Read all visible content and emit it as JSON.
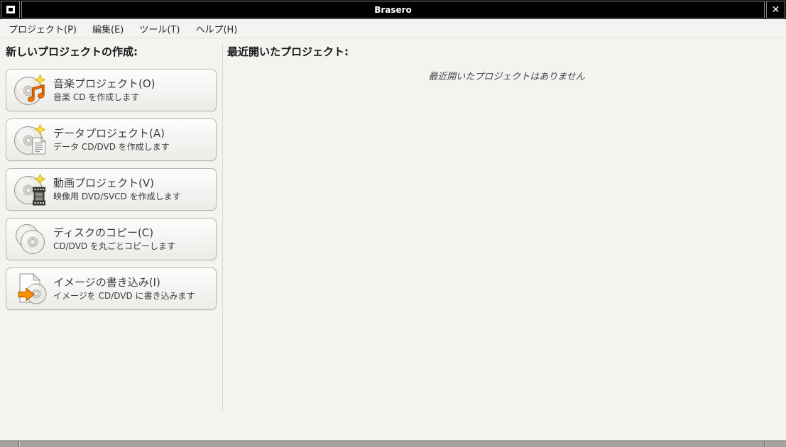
{
  "titlebar": {
    "title": "Brasero",
    "close_glyph": "✕"
  },
  "menu_bar": {
    "items": [
      {
        "label": "プロジェクト(P)"
      },
      {
        "label": "編集(E)"
      },
      {
        "label": "ツール(T)"
      },
      {
        "label": "ヘルプ(H)"
      }
    ]
  },
  "new_project_panel": {
    "header": "新しいプロジェクトの作成:",
    "buttons": [
      {
        "icon": "music-project-icon",
        "title": "音楽プロジェクト(O)",
        "subtitle": "音楽 CD を作成します"
      },
      {
        "icon": "data-project-icon",
        "title": "データプロジェクト(A)",
        "subtitle": "データ CD/DVD を作成します"
      },
      {
        "icon": "video-project-icon",
        "title": "動画プロジェクト(V)",
        "subtitle": "映像用 DVD/SVCD を作成します"
      },
      {
        "icon": "disc-copy-icon",
        "title": "ディスクのコピー(C)",
        "subtitle": "CD/DVD を丸ごとコピーします"
      },
      {
        "icon": "burn-image-icon",
        "title": "イメージの書き込み(I)",
        "subtitle": "イメージを CD/DVD に書き込みます"
      }
    ]
  },
  "recent_panel": {
    "header": "最近開いたプロジェクト:",
    "empty_message": "最近開いたプロジェクトはありません"
  },
  "colors": {
    "titlebar_bg": "#000000",
    "titlebar_text": "#ffffff",
    "window_bg": "#f4f3f0",
    "button_border": "#b9b7b3",
    "accent_orange": "#f57900",
    "sparkle_yellow": "#ffe14d",
    "bottom_panel_gray": "#a5a3a0"
  }
}
